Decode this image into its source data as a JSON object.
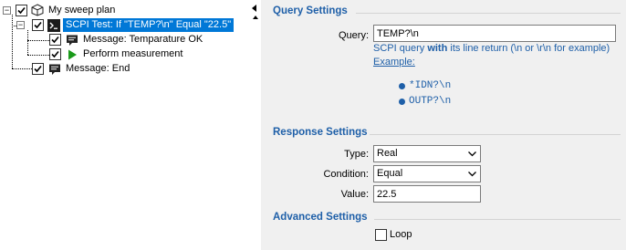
{
  "tree": {
    "root_label": "My sweep plan",
    "nodes": [
      {
        "label": "SCPI Test: If \"TEMP?\\n\" Equal \"22.5\"",
        "selected": true,
        "icon": "terminal-icon"
      },
      {
        "label": "Message: Temparature OK",
        "icon": "message-icon"
      },
      {
        "label": "Perform measurement",
        "icon": "play-icon"
      },
      {
        "label": "Message: End",
        "icon": "message-icon"
      }
    ],
    "expander_collapse_symbol": "−"
  },
  "query_settings": {
    "heading": "Query Settings",
    "query_label": "Query:",
    "query_value": "TEMP?\\n",
    "hint_prefix": "SCPI query ",
    "hint_bold": "with",
    "hint_suffix": " its line return (\\n or \\r\\n for example)",
    "example_link": "Example:",
    "examples": [
      "*IDN?\\n",
      "OUTP?\\n"
    ]
  },
  "response_settings": {
    "heading": "Response Settings",
    "type_label": "Type:",
    "type_value": "Real",
    "condition_label": "Condition:",
    "condition_value": "Equal",
    "value_label": "Value:",
    "value_value": "22.5"
  },
  "advanced_settings": {
    "heading": "Advanced Settings",
    "loop_label": "Loop",
    "loop_checked": false
  },
  "colors": {
    "accent": "#1e5fa8",
    "selection": "#0078d7",
    "panel_bg": "#f0f0f0",
    "play_green": "#1a9a1a"
  }
}
